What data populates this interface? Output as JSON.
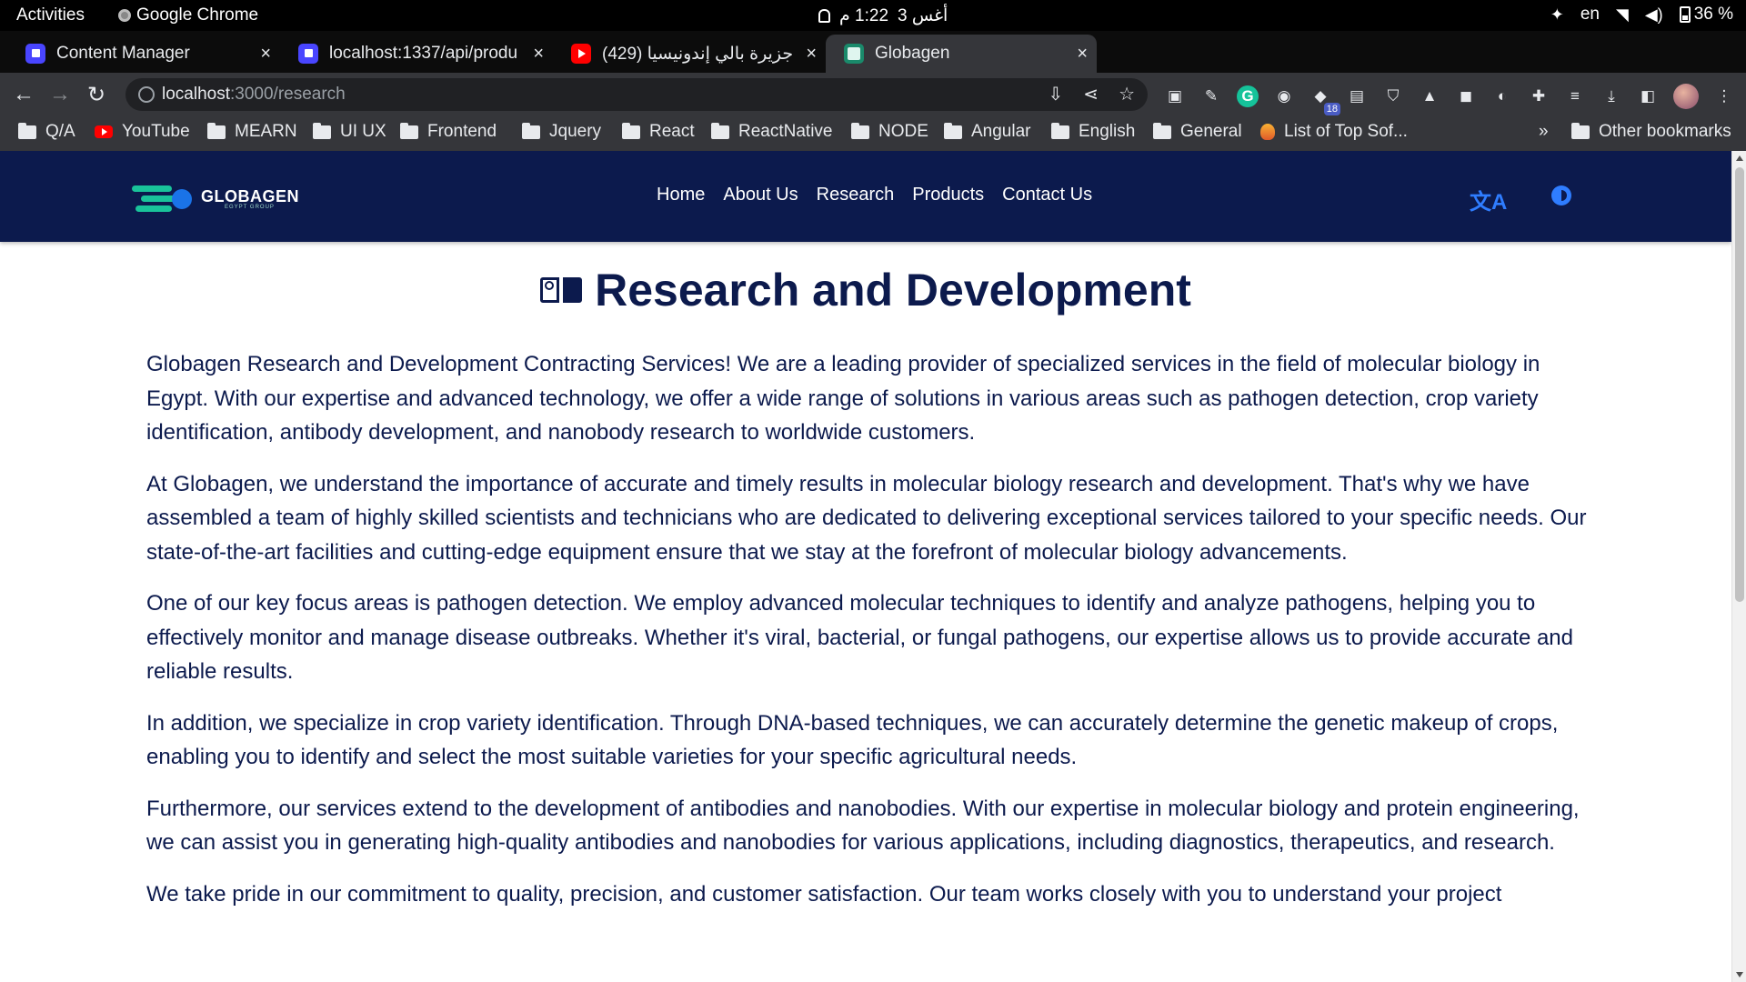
{
  "system": {
    "activities": "Activities",
    "app_name": "Google Chrome",
    "clock_date": "أغس 3",
    "clock_time": "1:22 م",
    "language": "en",
    "battery": "36 %"
  },
  "tabs": [
    {
      "title": "Content Manager",
      "active": false,
      "favicon": "strapi-icon"
    },
    {
      "title": "localhost:1337/api/produ",
      "active": false,
      "favicon": "strapi-icon"
    },
    {
      "title": "(429) جزيرة بالي إندونيسيا e",
      "active": false,
      "favicon": "youtube-icon"
    },
    {
      "title": "Globagen",
      "active": true,
      "favicon": "globagen-icon"
    }
  ],
  "toolbar": {
    "url_host": "localhost",
    "url_path": ":3000/research",
    "extension_badge": "18"
  },
  "bookmarks": [
    {
      "label": "Q/A",
      "icon": "folder-icon"
    },
    {
      "label": "YouTube",
      "icon": "youtube-icon"
    },
    {
      "label": "MEARN",
      "icon": "folder-icon"
    },
    {
      "label": "UI UX",
      "icon": "folder-icon"
    },
    {
      "label": "Frontend",
      "icon": "folder-icon"
    },
    {
      "label": "Jquery",
      "icon": "folder-icon"
    },
    {
      "label": "React",
      "icon": "folder-icon"
    },
    {
      "label": "ReactNative",
      "icon": "folder-icon"
    },
    {
      "label": "NODE",
      "icon": "folder-icon"
    },
    {
      "label": "Angular",
      "icon": "folder-icon"
    },
    {
      "label": "English",
      "icon": "folder-icon"
    },
    {
      "label": "General",
      "icon": "folder-icon"
    },
    {
      "label": "List of Top Sof...",
      "icon": "site-icon"
    }
  ],
  "bookmarks_overflow": "»",
  "other_bookmarks": "Other bookmarks",
  "site": {
    "logo_text": "GLOBAGEN",
    "logo_sub": "EGYPT GROUP",
    "nav": [
      "Home",
      "About Us",
      "Research",
      "Products",
      "Contact Us"
    ],
    "heading": "Research and Development",
    "paragraphs": [
      "Globagen Research and Development Contracting Services! We are a leading provider of specialized services in the field of molecular biology in Egypt. With our expertise and advanced technology, we offer a wide range of solutions in various areas such as pathogen detection, crop variety identification, antibody development, and nanobody research to worldwide customers.",
      "At Globagen, we understand the importance of accurate and timely results in molecular biology research and development. That's why we have assembled a team of highly skilled scientists and technicians who are dedicated to delivering exceptional services tailored to your specific needs. Our state-of-the-art facilities and cutting-edge equipment ensure that we stay at the forefront of molecular biology advancements.",
      "One of our key focus areas is pathogen detection. We employ advanced molecular techniques to identify and analyze pathogens, helping you to effectively monitor and manage disease outbreaks. Whether it's viral, bacterial, or fungal pathogens, our expertise allows us to provide accurate and reliable results.",
      "In addition, we specialize in crop variety identification. Through DNA-based techniques, we can accurately determine the genetic makeup of crops, enabling you to identify and select the most suitable varieties for your specific agricultural needs.",
      "Furthermore, our services extend to the development of antibodies and nanobodies. With our expertise in molecular biology and protein engineering, we can assist you in generating high-quality antibodies and nanobodies for various applications, including diagnostics, therapeutics, and research.",
      "We take pride in our commitment to quality, precision, and customer satisfaction. Our team works closely with you to understand your project"
    ]
  },
  "colors": {
    "brand_navy": "#0c1a4d",
    "accent_blue": "#2f7dff",
    "logo_green": "#19c39a"
  }
}
